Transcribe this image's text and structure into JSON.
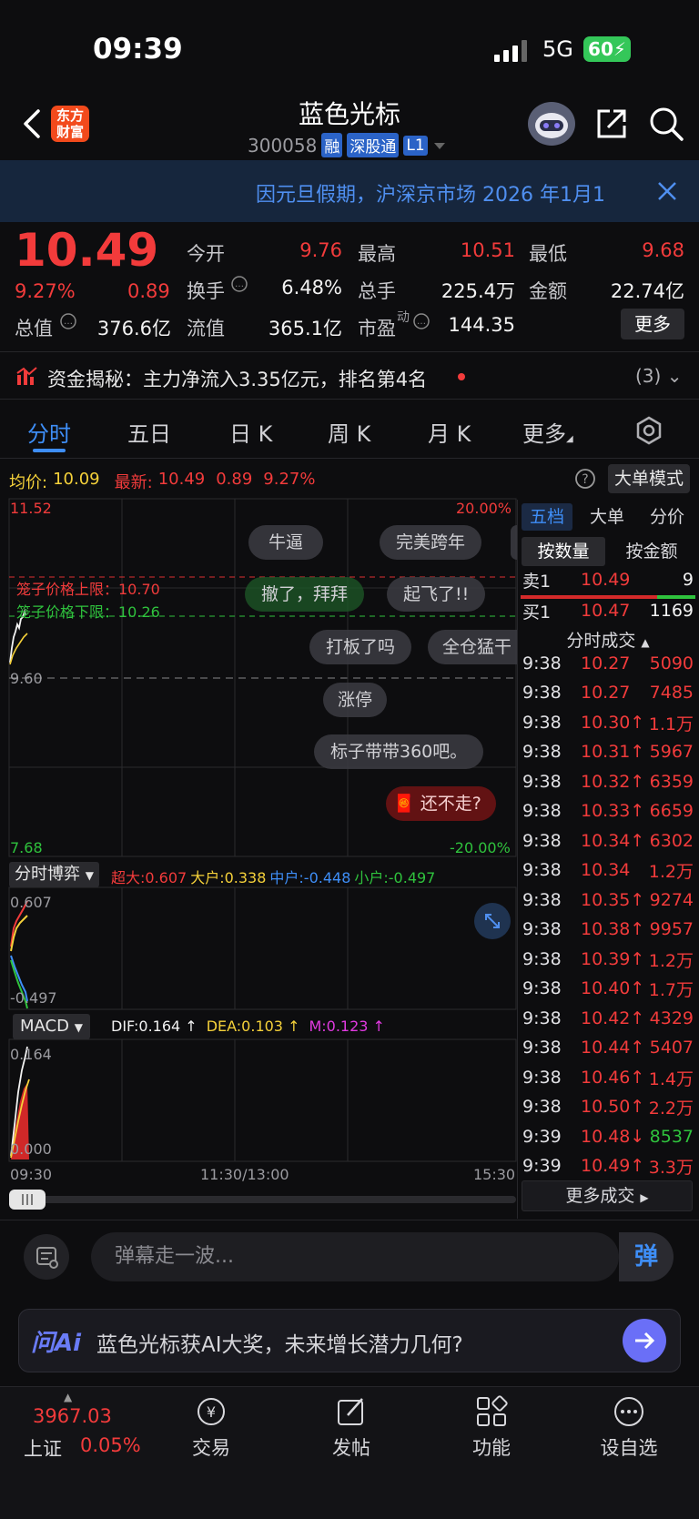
{
  "status_bar": {
    "time": "09:39",
    "network": "5G",
    "battery": "60"
  },
  "header": {
    "brand_line1": "东方",
    "brand_line2": "财富",
    "stock_name": "蓝色光标",
    "stock_code": "300058",
    "tags": [
      "融",
      "深股通",
      "L1"
    ]
  },
  "banner": {
    "text": "因元旦假期，沪深京市场 2026 年1月1"
  },
  "quote": {
    "price": "10.49",
    "change_pct": "9.27%",
    "change_amt": "0.89",
    "today_open_label": "今开",
    "today_open": "9.76",
    "high_label": "最高",
    "high": "10.51",
    "low_label": "最低",
    "low": "9.68",
    "turnover_label": "换手",
    "turnover": "6.48%",
    "volume_label": "总手",
    "volume": "225.4万",
    "amount_label": "金额",
    "amount": "22.74亿",
    "mktcap_label": "总值",
    "mktcap": "376.6亿",
    "float_label": "流值",
    "float_value": "365.1亿",
    "pe_label": "市盈",
    "pe_sup": "动",
    "pe": "144.35",
    "more_button": "更多"
  },
  "funds": {
    "text": "资金揭秘：主力净流入3.35亿元，排名第4名",
    "count": "(3)"
  },
  "tabs": [
    "分时",
    "五日",
    "日 K",
    "周 K",
    "月 K",
    "更多"
  ],
  "chart": {
    "avg_label": "均价:",
    "avg_value": "10.09",
    "latest_label": "最新:",
    "latest_price": "10.49",
    "latest_change": "0.89",
    "latest_pct": "9.27%",
    "big_order_button": "大单模式",
    "y_top": "11.52",
    "y_mid": "9.60",
    "y_bottom": "7.68",
    "pct_top": "20.00%",
    "pct_bottom": "-20.00%",
    "upper_limit_label": "笼子价格上限：10.70",
    "lower_limit_label": "笼子价格下限：10.26",
    "time_start": "09:30",
    "time_mid": "11:30/13:00",
    "time_end": "15:30",
    "danmu": [
      "牛逼",
      "完美跨年",
      "撤了，拜拜",
      "起飞了!!",
      "打板了吗",
      "全仓猛干",
      "涨停",
      "标子带带360吧。",
      "还不走?"
    ]
  },
  "game_panel": {
    "dropdown": "分时博弈",
    "super_label": "超大:0.607",
    "large_label": "大户:0.338",
    "mid_label": "中户:-0.448",
    "small_label": "小户:-0.497",
    "y_top": "0.607",
    "y_bottom": "-0.497"
  },
  "macd_panel": {
    "dropdown": "MACD",
    "dif": "DIF:0.164 ↑",
    "dea": "DEA:0.103 ↑",
    "m": "M:0.123 ↑",
    "y_top": "0.164",
    "y_bottom": "0.000"
  },
  "right_panel": {
    "tabs": [
      "五档",
      "大单",
      "分价"
    ],
    "sub_tabs": [
      "按数量",
      "按金额"
    ],
    "sell1_label": "卖1",
    "sell1_price": "10.49",
    "sell1_vol": "9",
    "buy1_label": "买1",
    "buy1_price": "10.47",
    "buy1_vol": "1169",
    "trades_header": "分时成交",
    "trades": [
      {
        "time": "9:38",
        "price": "10.27",
        "vol": "5090",
        "dir": "none"
      },
      {
        "time": "9:38",
        "price": "10.27",
        "vol": "7485",
        "dir": "none"
      },
      {
        "time": "9:38",
        "price": "10.30↑",
        "vol": "1.1万",
        "dir": "up"
      },
      {
        "time": "9:38",
        "price": "10.31↑",
        "vol": "5967",
        "dir": "up"
      },
      {
        "time": "9:38",
        "price": "10.32↑",
        "vol": "6359",
        "dir": "up"
      },
      {
        "time": "9:38",
        "price": "10.33↑",
        "vol": "6659",
        "dir": "up"
      },
      {
        "time": "9:38",
        "price": "10.34↑",
        "vol": "6302",
        "dir": "up"
      },
      {
        "time": "9:38",
        "price": "10.34",
        "vol": "1.2万",
        "dir": "none"
      },
      {
        "time": "9:38",
        "price": "10.35↑",
        "vol": "9274",
        "dir": "up"
      },
      {
        "time": "9:38",
        "price": "10.38↑",
        "vol": "9957",
        "dir": "up"
      },
      {
        "time": "9:38",
        "price": "10.39↑",
        "vol": "1.2万",
        "dir": "up"
      },
      {
        "time": "9:38",
        "price": "10.40↑",
        "vol": "1.7万",
        "dir": "up"
      },
      {
        "time": "9:38",
        "price": "10.42↑",
        "vol": "4329",
        "dir": "up"
      },
      {
        "time": "9:38",
        "price": "10.44↑",
        "vol": "5407",
        "dir": "up"
      },
      {
        "time": "9:38",
        "price": "10.46↑",
        "vol": "1.4万",
        "dir": "up"
      },
      {
        "time": "9:38",
        "price": "10.50↑",
        "vol": "2.2万",
        "dir": "up"
      },
      {
        "time": "9:39",
        "price": "10.48↓",
        "vol": "8537",
        "dir": "down"
      },
      {
        "time": "9:39",
        "price": "10.49↑",
        "vol": "3.3万",
        "dir": "up"
      }
    ],
    "more_trades": "更多成交"
  },
  "comment_bar": {
    "placeholder": "弹幕走一波...",
    "send_label": "弹"
  },
  "ai_bar": {
    "logo": "问Ai",
    "text": "蓝色光标获AI大奖，未来增长潜力几何?"
  },
  "bottom_nav": {
    "index_value": "3967.03",
    "index_name": "上证",
    "index_pct": "0.05%",
    "items": [
      "交易",
      "发帖",
      "功能",
      "设自选"
    ]
  },
  "colors": {
    "up": "#f23b3b",
    "down": "#2fc23d",
    "accent": "#3e8ef7",
    "avg": "#f5d13a"
  }
}
